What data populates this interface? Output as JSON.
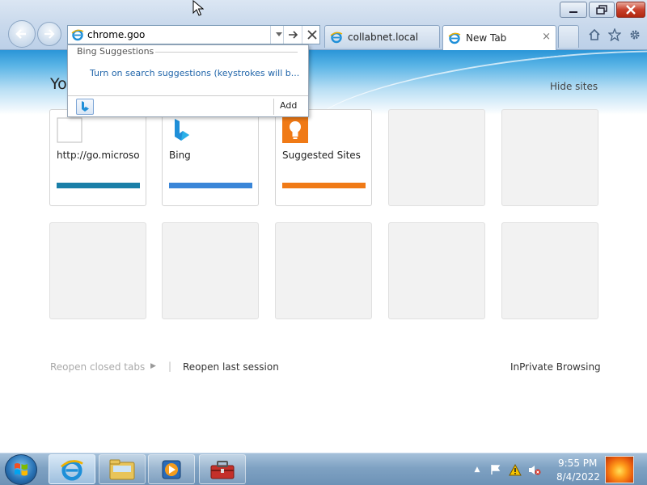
{
  "window": {
    "controls": {
      "minimize": "minimize",
      "maximize": "restore",
      "close": "close"
    }
  },
  "address_bar": {
    "value": "chrome.goo",
    "icon": "ie-icon"
  },
  "tabs": [
    {
      "label": "collabnet.local",
      "active": false
    },
    {
      "label": "New Tab",
      "active": true,
      "close": "×"
    }
  ],
  "toolbar": {
    "icons": [
      "home-icon",
      "favorites-star-icon",
      "gear-icon"
    ]
  },
  "suggestions": {
    "heading": "Bing Suggestions",
    "link": "Turn on search suggestions (keystrokes will b...",
    "add_label": "Add"
  },
  "newtab": {
    "title": "Yo",
    "hide_sites": "Hide sites",
    "tiles": [
      {
        "label": "http://go.microso",
        "bar_color": "#1a7fa8"
      },
      {
        "label": "Bing",
        "bar_color": "#3a86d8"
      },
      {
        "label": "Suggested Sites",
        "bar_color": "#f07a16"
      }
    ],
    "reopen_closed_tabs": "Reopen closed tabs",
    "separator": "|",
    "reopen_last_session": "Reopen last session",
    "inprivate": "InPrivate Browsing"
  },
  "taskbar": {
    "time": "9:55 PM",
    "date": "8/4/2022",
    "apps": [
      "internet-explorer",
      "windows-explorer",
      "media-player",
      "toolbox"
    ],
    "tray": [
      "show-hidden-icons-arrow",
      "action-center-flag-icon",
      "network-warning-icon",
      "volume-muted-icon"
    ]
  },
  "colors": {
    "accent": "#2a95d8",
    "link": "#2266aa",
    "close_red": "#c8402c"
  }
}
